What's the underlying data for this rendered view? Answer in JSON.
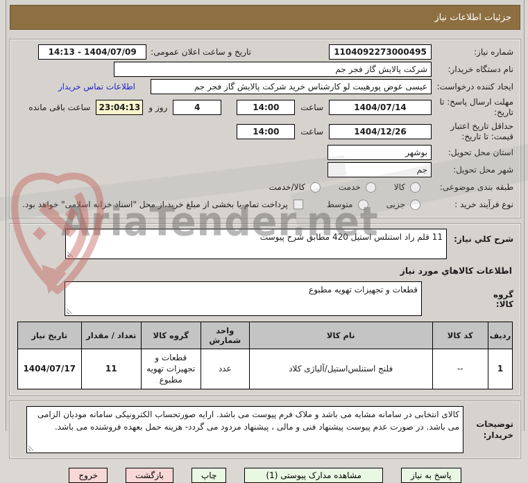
{
  "title": "جزئیات اطلاعات نیاز",
  "colors": {
    "header_brown": "#8d6f41",
    "button_green": "#e9f8e2",
    "button_pink": "#f8d7d7",
    "countdown_yellow": "#f8f5cf",
    "link_blue": "#2323cc",
    "table_header_gray": "#c4c4c4",
    "page_gray": "#d6d3ce"
  },
  "fields": {
    "need_number": {
      "label": "شماره نیاز:",
      "value": "1104092273000495"
    },
    "announce_datetime": {
      "label": "تاریخ و ساعت اعلان عمومی:",
      "value": "1404/07/09 - 14:13"
    },
    "buyer_org": {
      "label": "نام دستگاه خریدار:",
      "value": "شرکت پالایش گاز فجر جم"
    },
    "request_creator": {
      "label": "ایجاد کننده درخواست:",
      "value": "عیسی عوض پورهیبت لو کارشناس خرید شرکت پالایش گاز فجر جم",
      "contact_link": "اطلاعات تماس خریدار"
    },
    "reply_deadline": {
      "label": "مهلت ارسال پاسخ: تا تاریخ:",
      "date": "1404/07/14",
      "hour_label": "ساعت",
      "time": "14:00",
      "days_left": "4",
      "days_sep": "روز و",
      "countdown": "23:04:13",
      "remaining_label": "ساعت باقی مانده"
    },
    "price_validity": {
      "label": "حداقل تاریخ اعتبار قیمت: تا تاریخ:",
      "date": "1404/12/26",
      "hour_label": "ساعت",
      "time": "14:00"
    },
    "province": {
      "label": "استان محل تحویل:",
      "value": "بوشهر"
    },
    "city": {
      "label": "شهر محل تحویل:",
      "value": "جم"
    },
    "subject_class": {
      "label": "طبقه بندی موضوعی:",
      "options": [
        "کالا",
        "خدمت",
        "کالا/خدمت"
      ]
    },
    "purchase_type": {
      "label": "نوع فرآیند خرید :",
      "options": [
        "جزیی",
        "متوسط"
      ],
      "checkbox_label": "پرداخت تمام یا بخشی از مبلغ خرید،از محل \"اسناد خزانه اسلامی\" خواهد بود."
    }
  },
  "need_desc": {
    "label": "شرح کلي نیاز:",
    "value": "11 قلم راد استنلس استیل 420 مطابق شرح پیوست"
  },
  "goods_section": {
    "header": "اطلاعات کالاهاي مورد نیاز",
    "group_label": "گروه کالا:",
    "group_value": "قطعات و تجهیزات تهویه مطبوع"
  },
  "table": {
    "headers": [
      "ردیف",
      "کد کالا",
      "نام کالا",
      "واحد شمارش",
      "گروه کالا",
      "تعداد / مقدار",
      "تاریخ نیاز"
    ],
    "rows": [
      [
        "1",
        "--",
        "فلنج استنلس‌استیل/آلیاژی کلاد",
        "عدد",
        "قطعات و تجهیزات تهویه مطبوع",
        "11",
        "1404/07/17"
      ]
    ]
  },
  "buyer_notes": {
    "label": "توضیحات خریدار:",
    "value": "کالای انتخابی در سامانه مشابه می باشد و ملاک فرم پیوست می باشد.  ارایه صورتحساب الکترونیکی سامانه مودیان الزامی می باشد. در صورت عدم پیوست پیشنهاد فنی و مالی ، پیشنهاد مردود می گردد- هزینه حمل بعهده فروشنده می باشد."
  },
  "buttons": {
    "respond": "پاسخ به نیاز",
    "view_docs": "مشاهده مدارک پیوستی (1)",
    "print": "چاپ",
    "back": "بازگشت",
    "exit": "خروج"
  },
  "watermark": {
    "text": "AriaTender.net"
  }
}
